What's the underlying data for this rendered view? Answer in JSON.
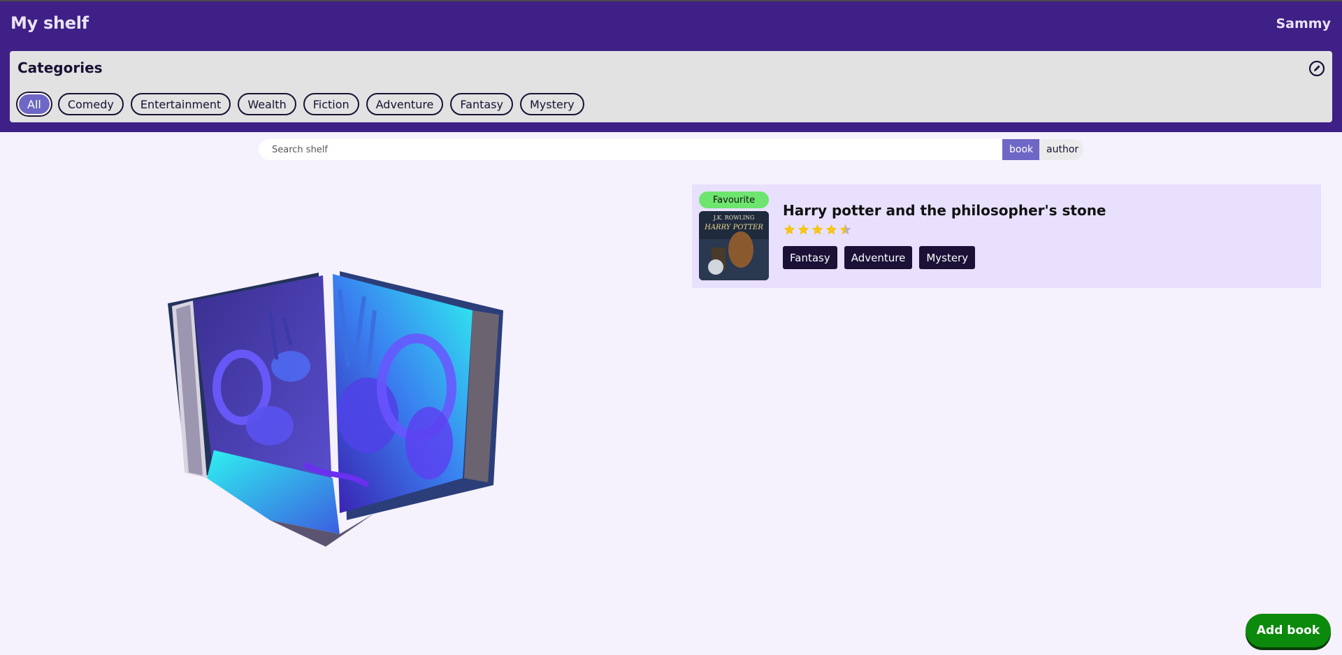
{
  "header": {
    "title": "My shelf",
    "user": "Sammy"
  },
  "categories": {
    "title": "Categories",
    "edit_icon": "edit-circle-icon",
    "items": [
      "All",
      "Comedy",
      "Entertainment",
      "Wealth",
      "Fiction",
      "Adventure",
      "Fantasy",
      "Mystery"
    ],
    "selected": "All"
  },
  "search": {
    "placeholder": "Search shelf",
    "value": "",
    "modes": [
      "book",
      "author"
    ],
    "active_mode": "book"
  },
  "books": [
    {
      "badge": "Favourite",
      "title": "Harry potter and the philosopher's stone",
      "rating": 4.5,
      "rating_max": 5,
      "tags": [
        "Fantasy",
        "Adventure",
        "Mystery"
      ],
      "cover": {
        "author": "J.K. ROWLING",
        "title": "HARRY POTTER"
      }
    }
  ],
  "actions": {
    "add_book": "Add book"
  },
  "colors": {
    "header_bg": "#3f2086",
    "accent": "#6f67c5",
    "page_bg": "#f5f1fd",
    "card_bg": "#e8e0fd",
    "favourite": "#6ee56f",
    "star": "#f5c518",
    "add_button": "#0c8a0c"
  }
}
